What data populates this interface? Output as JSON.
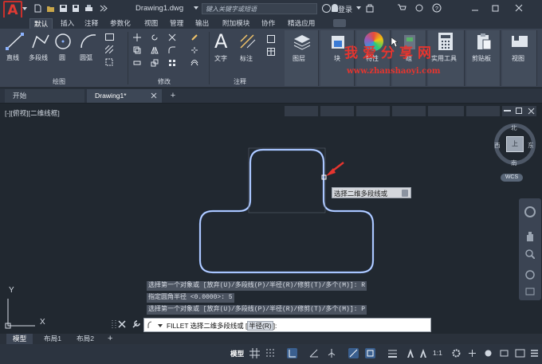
{
  "app": {
    "title": "Drawing1.dwg",
    "search_placeholder": "键入关键字或短语",
    "login": "登录"
  },
  "menu_tabs": [
    "默认",
    "插入",
    "注释",
    "参数化",
    "视图",
    "管理",
    "输出",
    "附加模块",
    "协作",
    "精选应用"
  ],
  "ribbon": {
    "draw": {
      "line": "直线",
      "polyline": "多段线",
      "circle": "圆",
      "arc": "圆弧",
      "panel": "绘图"
    },
    "modify": {
      "panel": "修改"
    },
    "annotation": {
      "text": "文字",
      "dimension": "标注",
      "panel": "注释"
    },
    "layers": "图层",
    "block": "块",
    "properties": "特性",
    "groups": "组",
    "utilities": "实用工具",
    "clipboard": "剪贴板",
    "view": "视图"
  },
  "doc_tabs": {
    "start": "开始",
    "drawing": "Drawing1*"
  },
  "viewport": {
    "label": "[-][俯视][二维线框]",
    "wcs": "WCS",
    "north": "北",
    "south": "南",
    "east": "东",
    "west": "西",
    "top": "上"
  },
  "tooltip": "选择二维多段线或",
  "watermark": {
    "cn": "我爱分享网",
    "url": "www.zhanshaoyi.com"
  },
  "command_history": [
    "选择第一个对象或 [放弃(U)/多段线(P)/半径(R)/修剪(T)/多个(M)]: R",
    "指定圆角半径 <0.0000>: 5",
    "选择第一个对象或 [放弃(U)/多段线(P)/半径(R)/修剪(T)/多个(M)]: P"
  ],
  "command_line": {
    "prefix": "FILLET 选择二维多段线或 [",
    "option": "半径(R)",
    "suffix": "]:"
  },
  "layout_tabs": [
    "模型",
    "布局1",
    "布局2"
  ],
  "status": {
    "model": "模型",
    "scale": "1:1"
  },
  "ucs": {
    "x": "X",
    "y": "Y"
  },
  "colors": {
    "accent": "#3a7bd5",
    "shape_stroke": "#8cb3ff",
    "arrow": "#e5352f"
  }
}
